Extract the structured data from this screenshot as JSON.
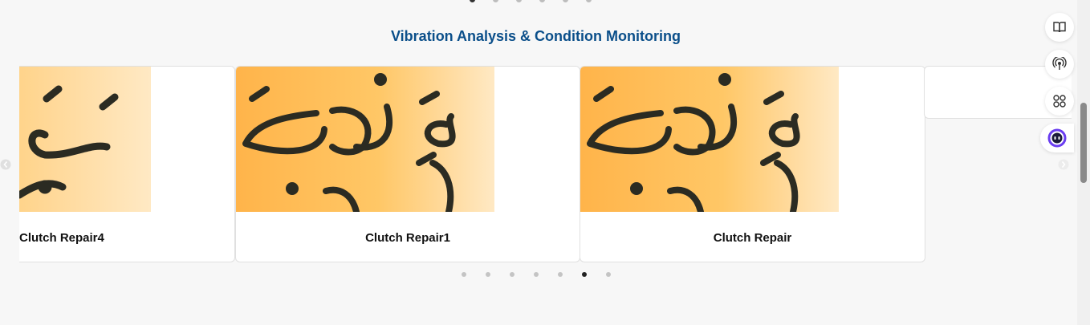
{
  "section": {
    "title": "Vibration Analysis & Condition Monitoring"
  },
  "cards": [
    {
      "caption": "Clutch Repair4"
    },
    {
      "caption": "Clutch Repair1"
    },
    {
      "caption": "Clutch Repair"
    }
  ],
  "carousel": {
    "slide_count": 7,
    "active_index": 5
  },
  "top_pager": {
    "dot_count": 6,
    "active_index": 0
  },
  "toolbar": {
    "icons": [
      "book-icon",
      "broadcast-icon",
      "apps-grid-icon",
      "copilot-icon"
    ]
  },
  "colors": {
    "title": "#0b4f8a",
    "paper": "#ffb44a",
    "copilot_ring": "#6a3df0"
  }
}
